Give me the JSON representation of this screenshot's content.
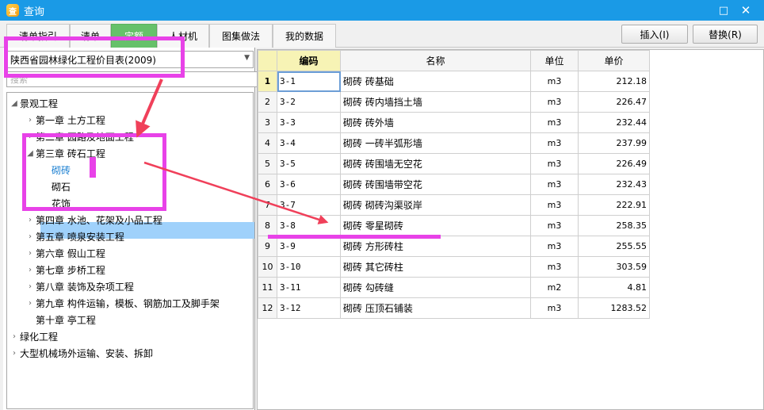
{
  "window": {
    "title": "查询",
    "maximize_glyph": "□",
    "close_glyph": "✕",
    "app_icon_glyph": "查"
  },
  "tabs": [
    {
      "label": "清单指引"
    },
    {
      "label": "清单"
    },
    {
      "label": "定额",
      "active": true
    },
    {
      "label": "人材机"
    },
    {
      "label": "图集做法"
    },
    {
      "label": "我的数据"
    }
  ],
  "actions": {
    "insert": "插入(I)",
    "replace": "替换(R)"
  },
  "library_select": {
    "value": "陕西省园林绿化工程价目表(2009)"
  },
  "search": {
    "placeholder": "搜索"
  },
  "tree": {
    "root1": "景观工程",
    "ch1": "第一章  土方工程",
    "ch2": "第二章  园路及地面工程",
    "ch3": "第三章  砖石工程",
    "ch3_1": "砌砖",
    "ch3_2": "砌石",
    "ch3_3": "花饰",
    "ch4": "第四章  水池、花架及小品工程",
    "ch5": "第五章  喷泉安装工程",
    "ch6": "第六章  假山工程",
    "ch7": "第七章  步桥工程",
    "ch8": "第八章  装饰及杂项工程",
    "ch9": "第九章  构件运输，模板、钢筋加工及脚手架",
    "ch10": "第十章  亭工程",
    "root2": "绿化工程",
    "root3": "大型机械场外运输、安装、拆卸"
  },
  "grid": {
    "headers": {
      "code": "编码",
      "name": "名称",
      "unit": "单位",
      "price": "单价"
    },
    "rows": [
      {
        "n": "1",
        "code": "3-1",
        "name": "砌砖  砖基础",
        "unit": "m3",
        "price": "212.18"
      },
      {
        "n": "2",
        "code": "3-2",
        "name": "砌砖  砖内墙挡土墙",
        "unit": "m3",
        "price": "226.47"
      },
      {
        "n": "3",
        "code": "3-3",
        "name": "砌砖  砖外墙",
        "unit": "m3",
        "price": "232.44"
      },
      {
        "n": "4",
        "code": "3-4",
        "name": "砌砖  一砖半弧形墙",
        "unit": "m3",
        "price": "237.99"
      },
      {
        "n": "5",
        "code": "3-5",
        "name": "砌砖  砖围墙无空花",
        "unit": "m3",
        "price": "226.49"
      },
      {
        "n": "6",
        "code": "3-6",
        "name": "砌砖  砖围墙带空花",
        "unit": "m3",
        "price": "232.43"
      },
      {
        "n": "7",
        "code": "3-7",
        "name": "砌砖  砌砖沟渠驳岸",
        "unit": "m3",
        "price": "222.91"
      },
      {
        "n": "8",
        "code": "3-8",
        "name": "砌砖  零星砌砖",
        "unit": "m3",
        "price": "258.35"
      },
      {
        "n": "9",
        "code": "3-9",
        "name": "砌砖  方形砖柱",
        "unit": "m3",
        "price": "255.55"
      },
      {
        "n": "10",
        "code": "3-10",
        "name": "砌砖  其它砖柱",
        "unit": "m3",
        "price": "303.59"
      },
      {
        "n": "11",
        "code": "3-11",
        "name": "砌砖  勾砖缝",
        "unit": "m2",
        "price": "4.81"
      },
      {
        "n": "12",
        "code": "3-12",
        "name": "砌砖  压顶石铺装",
        "unit": "m3",
        "price": "1283.52"
      }
    ]
  },
  "colors": {
    "titlebar": "#1a9ae6",
    "active_tab": "#66c16a",
    "annotation": "#e842e8",
    "annotation_arrow": "#f0405a",
    "tree_selection": "#9fd1fb",
    "header_highlight": "#f7f3b5"
  }
}
